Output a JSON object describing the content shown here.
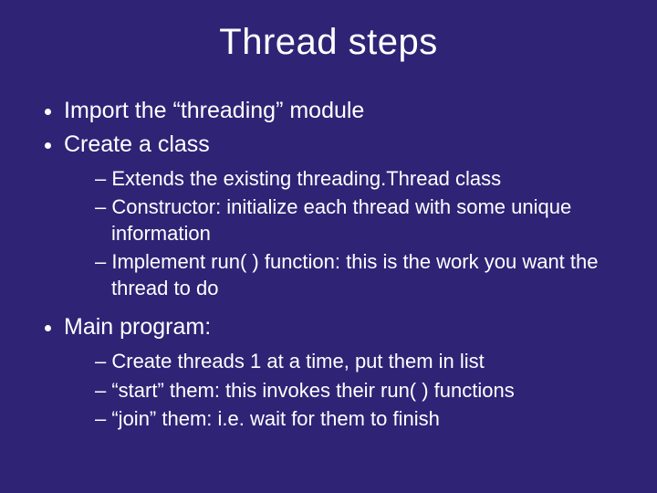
{
  "title": "Thread steps",
  "bullets": {
    "b1": "Import the “threading” module",
    "b2": "Create a class",
    "b2_sub": {
      "s1": "Extends the existing threading.Thread class",
      "s2": "Constructor:  initialize each thread with some unique information",
      "s3": "Implement run( ) function:  this is the work you want the thread to do"
    },
    "b3": "Main program:",
    "b3_sub": {
      "s1": "Create threads 1 at a time, put them in list",
      "s2": "“start” them:  this invokes their run( ) functions",
      "s3": "“join” them:  i.e. wait for them to finish"
    }
  }
}
